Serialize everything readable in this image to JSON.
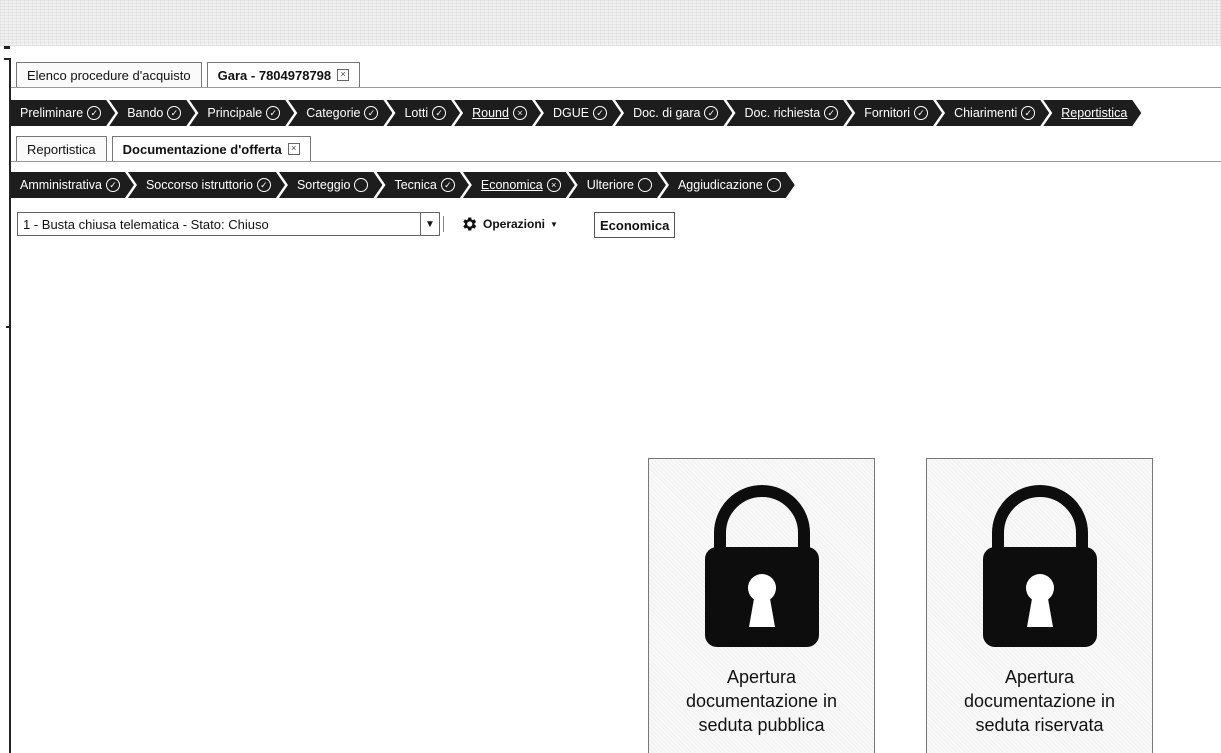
{
  "top_tabs": [
    {
      "label": "Elenco procedure d'acquisto",
      "active": false,
      "closable": false
    },
    {
      "label": "Gara - 7804978798",
      "active": true,
      "closable": true
    }
  ],
  "workflow_steps": [
    {
      "label": "Preliminare",
      "status": "check"
    },
    {
      "label": "Bando",
      "status": "check"
    },
    {
      "label": "Principale",
      "status": "check"
    },
    {
      "label": "Categorie",
      "status": "check"
    },
    {
      "label": "Lotti",
      "status": "check"
    },
    {
      "label": "Round",
      "status": "x",
      "linked": true
    },
    {
      "label": "DGUE",
      "status": "check"
    },
    {
      "label": "Doc. di gara",
      "status": "check"
    },
    {
      "label": "Doc. richiesta",
      "status": "check"
    },
    {
      "label": "Fornitori",
      "status": "check"
    },
    {
      "label": "Chiarimenti",
      "status": "check"
    },
    {
      "label": "Reportistica",
      "status": "",
      "linked": true
    }
  ],
  "sub_tabs": [
    {
      "label": "Reportistica",
      "active": false,
      "closable": false
    },
    {
      "label": "Documentazione d'offerta",
      "active": true,
      "closable": true
    }
  ],
  "offer_steps": [
    {
      "label": "Amministrativa",
      "status": "check"
    },
    {
      "label": "Soccorso istruttorio",
      "status": "check"
    },
    {
      "label": "Sorteggio",
      "status": "empty"
    },
    {
      "label": "Tecnica",
      "status": "check"
    },
    {
      "label": "Economica",
      "status": "x",
      "linked": true
    },
    {
      "label": "Ulteriore",
      "status": "empty"
    },
    {
      "label": "Aggiudicazione",
      "status": "empty"
    }
  ],
  "toolbar": {
    "busta_select_value": "1 - Busta chiusa telematica - Stato: Chiuso",
    "operazioni_label": "Operazioni",
    "economica_label": "Economica"
  },
  "cards": [
    {
      "label": "Apertura documentazione in seduta pubblica",
      "icon": "lock-icon"
    },
    {
      "label": "Apertura documentazione in seduta riservata",
      "icon": "lock-icon"
    }
  ],
  "icons": {
    "close": "close-icon",
    "gear": "gear-icon",
    "status_check": "check-circle-icon",
    "status_x": "x-circle-icon",
    "status_empty": "empty-circle-icon"
  },
  "colors": {
    "chevron_bg": "#1d1d1d",
    "chevron_text": "#ffffff"
  }
}
